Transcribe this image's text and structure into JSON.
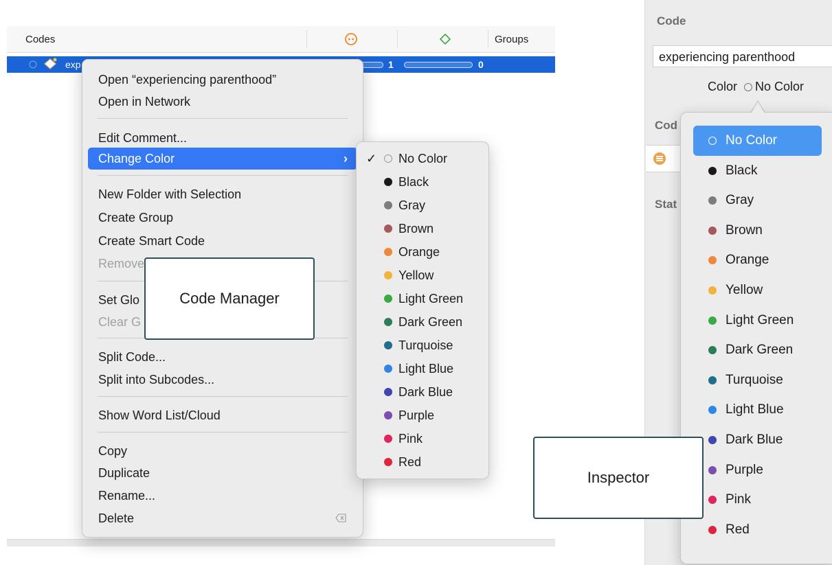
{
  "code_manager": {
    "columns": {
      "codes": "Codes",
      "groups": "Groups"
    },
    "row": {
      "label": "exp",
      "count_a": "1",
      "count_b": "0"
    }
  },
  "context_menu": [
    {
      "label": "Open “experiencing parenthood”",
      "state": "normal"
    },
    {
      "label": "Open in Network",
      "state": "normal"
    },
    {
      "label": "Edit Comment...",
      "state": "normal"
    },
    {
      "label": "Change Color",
      "state": "selected",
      "submenu": true
    },
    {
      "label": "New Folder with Selection",
      "state": "normal"
    },
    {
      "label": "Create Group",
      "state": "normal"
    },
    {
      "label": "Create Smart Code",
      "state": "normal"
    },
    {
      "label": "Remove",
      "state": "disabled"
    },
    {
      "label": "Set Glo",
      "state": "normal"
    },
    {
      "label": "Clear G",
      "state": "disabled"
    },
    {
      "label": "Split Code...",
      "state": "normal"
    },
    {
      "label": "Split into Subcodes...",
      "state": "normal"
    },
    {
      "label": "Show Word List/Cloud",
      "state": "normal"
    },
    {
      "label": "Copy",
      "state": "normal"
    },
    {
      "label": "Duplicate",
      "state": "normal"
    },
    {
      "label": "Rename...",
      "state": "normal"
    },
    {
      "label": "Delete",
      "state": "normal"
    }
  ],
  "color_options": [
    {
      "label": "No Color",
      "color": "none",
      "checked": true
    },
    {
      "label": "Black",
      "color": "#1a1a1a"
    },
    {
      "label": "Gray",
      "color": "#7d7d7d"
    },
    {
      "label": "Brown",
      "color": "#a45a5a"
    },
    {
      "label": "Orange",
      "color": "#f0883a"
    },
    {
      "label": "Yellow",
      "color": "#f2b33a"
    },
    {
      "label": "Light Green",
      "color": "#3aaa45"
    },
    {
      "label": "Dark Green",
      "color": "#2e7d5a"
    },
    {
      "label": "Turquoise",
      "color": "#1f6e8c"
    },
    {
      "label": "Light Blue",
      "color": "#2f86e6"
    },
    {
      "label": "Dark Blue",
      "color": "#4046b0"
    },
    {
      "label": "Purple",
      "color": "#7a4fb0"
    },
    {
      "label": "Pink",
      "color": "#e0245e"
    },
    {
      "label": "Red",
      "color": "#e0243e"
    }
  ],
  "callouts": {
    "code_manager": "Code Manager",
    "inspector": "Inspector"
  },
  "inspector": {
    "title": "Code",
    "code_name": "experiencing parenthood",
    "color_label": "Color",
    "color_value": "No Color",
    "partial_labels": [
      "Cod",
      "Stat"
    ]
  }
}
